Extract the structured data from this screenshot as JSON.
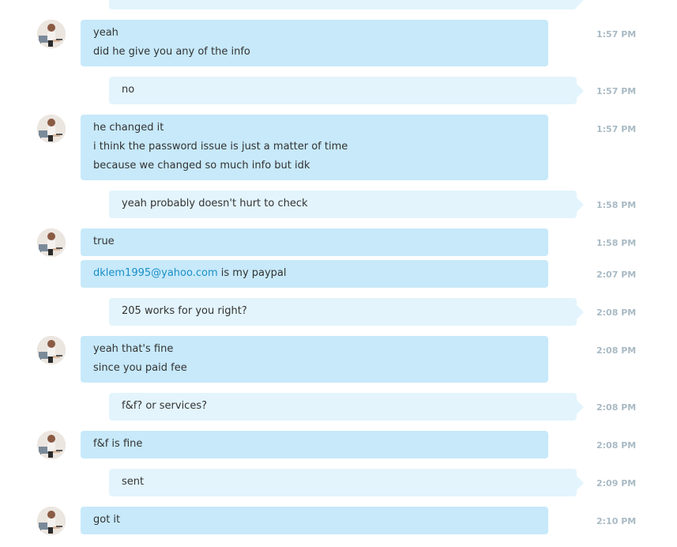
{
  "conversation": {
    "m1": {
      "lines": [
        "yeah",
        "did he give you any of the info"
      ],
      "time": "1:57 PM"
    },
    "m2": {
      "lines": [
        "no"
      ],
      "time": "1:57 PM"
    },
    "m3": {
      "lines": [
        "he changed it",
        "i think the password issue is just a matter of time",
        "because we changed so much info but idk"
      ],
      "time": "1:57 PM"
    },
    "m4": {
      "lines": [
        "yeah probably doesn't hurt to check"
      ],
      "time": "1:58 PM"
    },
    "m5": {
      "lines": [
        "true"
      ],
      "time": "1:58 PM"
    },
    "m6": {
      "email": "dklem1995@yahoo.com",
      "rest": " is my paypal",
      "time": "2:07 PM"
    },
    "m7": {
      "lines": [
        "205 works for you right?"
      ],
      "time": "2:08 PM"
    },
    "m8": {
      "lines": [
        "yeah that's fine",
        "since you paid fee"
      ],
      "time": "2:08 PM"
    },
    "m9": {
      "lines": [
        "f&f? or services?"
      ],
      "time": "2:08 PM"
    },
    "m10": {
      "lines": [
        "f&f is fine"
      ],
      "time": "2:08 PM"
    },
    "m11": {
      "lines": [
        "sent"
      ],
      "time": "2:09 PM"
    },
    "m12": {
      "lines": [
        "got it"
      ],
      "time": "2:10 PM"
    }
  },
  "colors": {
    "incoming_bubble": "#c7e9fa",
    "outgoing_bubble": "#e3f4fc",
    "link": "#1a8fc6",
    "timestamp": "#a9bac4"
  },
  "icons": {
    "avatar": "contact-avatar-photo"
  }
}
